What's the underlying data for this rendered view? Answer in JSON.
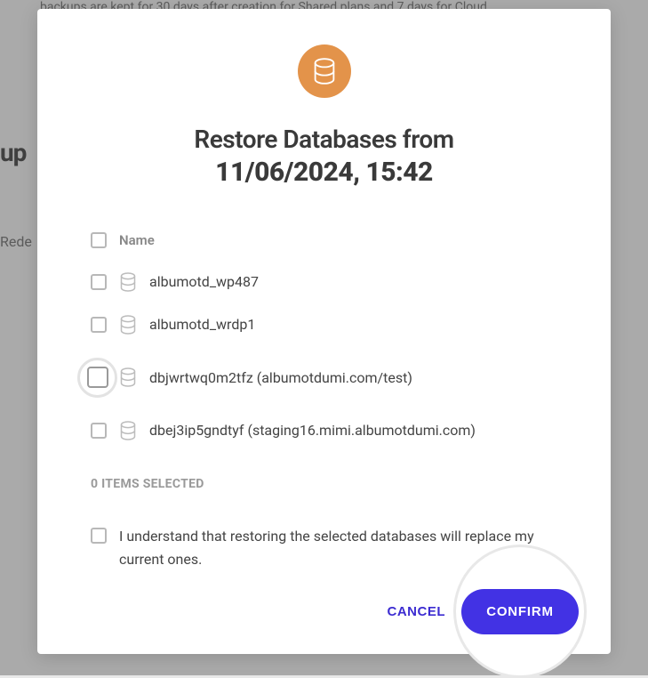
{
  "backdrop": {
    "text_fragment": "backups are kept for 30 days after creation for Shared plans and 7 days for Cloud.",
    "partial_left_1": "up",
    "partial_left_2": "Rede"
  },
  "modal": {
    "title_prefix": "Restore Databases from",
    "title_date": "11/06/2024, 15:42",
    "name_header": "Name",
    "databases": [
      {
        "name": "albumotd_wp487",
        "highlighted": false
      },
      {
        "name": "albumotd_wrdp1",
        "highlighted": false
      },
      {
        "name": "dbjwrtwq0m2tfz (albumotdumi.com/test)",
        "highlighted": true
      },
      {
        "name": "dbej3ip5gndtyf (staging16.mimi.albumotdumi.com)",
        "highlighted": false
      }
    ],
    "selected_count_label": "0 ITEMS SELECTED",
    "consent_text": "I understand that restoring the selected databases will replace my current ones.",
    "cancel_label": "CANCEL",
    "confirm_label": "CONFIRM"
  }
}
